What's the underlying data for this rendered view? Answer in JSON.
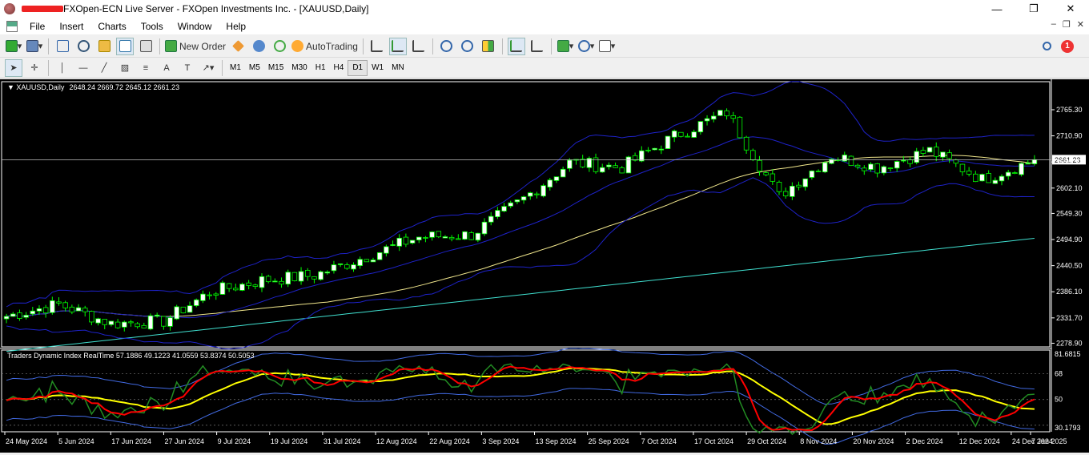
{
  "window": {
    "title": "FXOpen-ECN Live Server - FXOpen Investments Inc. - [XAUUSD,Daily]",
    "controls": [
      "—",
      "❐",
      "✕"
    ]
  },
  "menu": {
    "items": [
      "File",
      "Insert",
      "Charts",
      "Tools",
      "Window",
      "Help"
    ]
  },
  "toolbar": {
    "new_order_label": "New Order",
    "autotrading_label": "AutoTrading",
    "alert_count": "1"
  },
  "timeframes": [
    "M1",
    "M5",
    "M15",
    "M30",
    "H1",
    "H4",
    "D1",
    "W1",
    "MN"
  ],
  "active_timeframe": "D1",
  "colors": {
    "chart_bg": "#000000",
    "bull_candle": "#ffffff",
    "bear_candle": "#000000",
    "candle_wick": "#00ff00",
    "bollinger": "#1e22c8",
    "ma_slow": "#40e0d0",
    "ma_mid": "#f0e68c",
    "tdi_green": "#228b22",
    "tdi_red": "#ff0000",
    "tdi_yellow": "#ffff00",
    "tdi_band": "#4169e1"
  },
  "chart_data": {
    "type": "candlestick",
    "symbol_header": "XAUUSD,Daily",
    "ohlc_header": "2648.24 2669.72 2645.12 2661.23",
    "current_price_label": "2661.23",
    "y_ticks": [
      "2765.30",
      "2710.90",
      "2656.50",
      "2602.10",
      "2549.30",
      "2494.90",
      "2440.50",
      "2386.10",
      "2331.70",
      "2278.90"
    ],
    "y_tick_values": [
      2765.3,
      2710.9,
      2656.5,
      2602.1,
      2549.3,
      2494.9,
      2440.5,
      2386.1,
      2331.7,
      2278.9
    ],
    "ylim": [
      2273,
      2822
    ],
    "x_ticks": [
      "24 May 2024",
      "5 Jun 2024",
      "17 Jun 2024",
      "27 Jun 2024",
      "9 Jul 2024",
      "19 Jul 2024",
      "31 Jul 2024",
      "12 Aug 2024",
      "22 Aug 2024",
      "3 Sep 2024",
      "13 Sep 2024",
      "25 Sep 2024",
      "7 Oct 2024",
      "17 Oct 2024",
      "29 Oct 2024",
      "8 Nov 2024",
      "20 Nov 2024",
      "2 Dec 2024",
      "12 Dec 2024",
      "24 Dec 2024",
      "7 Jan 2025"
    ],
    "price_anchors": [
      {
        "date": "24 May 2024",
        "price": 2335
      },
      {
        "date": "5 Jun 2024",
        "price": 2360
      },
      {
        "date": "17 Jun 2024",
        "price": 2320
      },
      {
        "date": "27 Jun 2024",
        "price": 2325
      },
      {
        "date": "9 Jul 2024",
        "price": 2385
      },
      {
        "date": "19 Jul 2024",
        "price": 2410
      },
      {
        "date": "31 Jul 2024",
        "price": 2420
      },
      {
        "date": "12 Aug 2024",
        "price": 2460
      },
      {
        "date": "22 Aug 2024",
        "price": 2500
      },
      {
        "date": "3 Sep 2024",
        "price": 2505
      },
      {
        "date": "13 Sep 2024",
        "price": 2580
      },
      {
        "date": "25 Sep 2024",
        "price": 2655
      },
      {
        "date": "7 Oct 2024",
        "price": 2645
      },
      {
        "date": "17 Oct 2024",
        "price": 2710
      },
      {
        "date": "29 Oct 2024",
        "price": 2760
      },
      {
        "date": "8 Nov 2024",
        "price": 2585
      },
      {
        "date": "20 Nov 2024",
        "price": 2670
      },
      {
        "date": "2 Dec 2024",
        "price": 2645
      },
      {
        "date": "12 Dec 2024",
        "price": 2680
      },
      {
        "date": "24 Dec 2024",
        "price": 2620
      },
      {
        "date": "7 Jan 2025",
        "price": 2661
      }
    ],
    "indicator": {
      "header": "Traders Dynamic Index RealTime 57.1886 49.1223 41.0559 53.8374 50.5053",
      "y_ticks": [
        "81.6815",
        "68",
        "50",
        "30.1793"
      ],
      "y_tick_values": [
        81.6815,
        68,
        50,
        30.1793
      ],
      "ylim": [
        28,
        84
      ]
    }
  }
}
